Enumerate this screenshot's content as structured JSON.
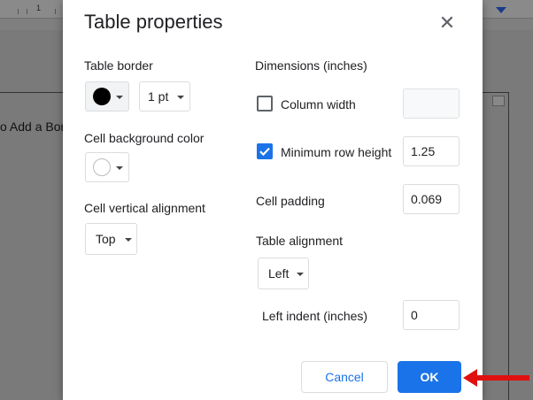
{
  "background": {
    "ruler_number": "1",
    "doc_text": "o Add a Bor"
  },
  "dialog": {
    "title": "Table properties",
    "close_icon": "close-icon",
    "table_border": {
      "label": "Table border",
      "color": "#000000",
      "width_value": "1 pt"
    },
    "cell_bg": {
      "label": "Cell background color",
      "color": "#ffffff"
    },
    "cell_valign": {
      "label": "Cell vertical alignment",
      "value": "Top"
    },
    "dimensions": {
      "label": "Dimensions  (inches)",
      "column_width": {
        "label": "Column width",
        "checked": false,
        "value": ""
      },
      "min_row_height": {
        "label": "Minimum row height",
        "checked": true,
        "value": "1.25"
      },
      "cell_padding": {
        "label": "Cell padding",
        "value": "0.069"
      }
    },
    "table_alignment": {
      "label": "Table alignment",
      "value": "Left",
      "left_indent": {
        "label": "Left indent  (inches)",
        "value": "0"
      }
    },
    "footer": {
      "cancel_label": "Cancel",
      "ok_label": "OK"
    }
  },
  "colors": {
    "accent": "#1a73e8",
    "arrow": "#e01010"
  }
}
